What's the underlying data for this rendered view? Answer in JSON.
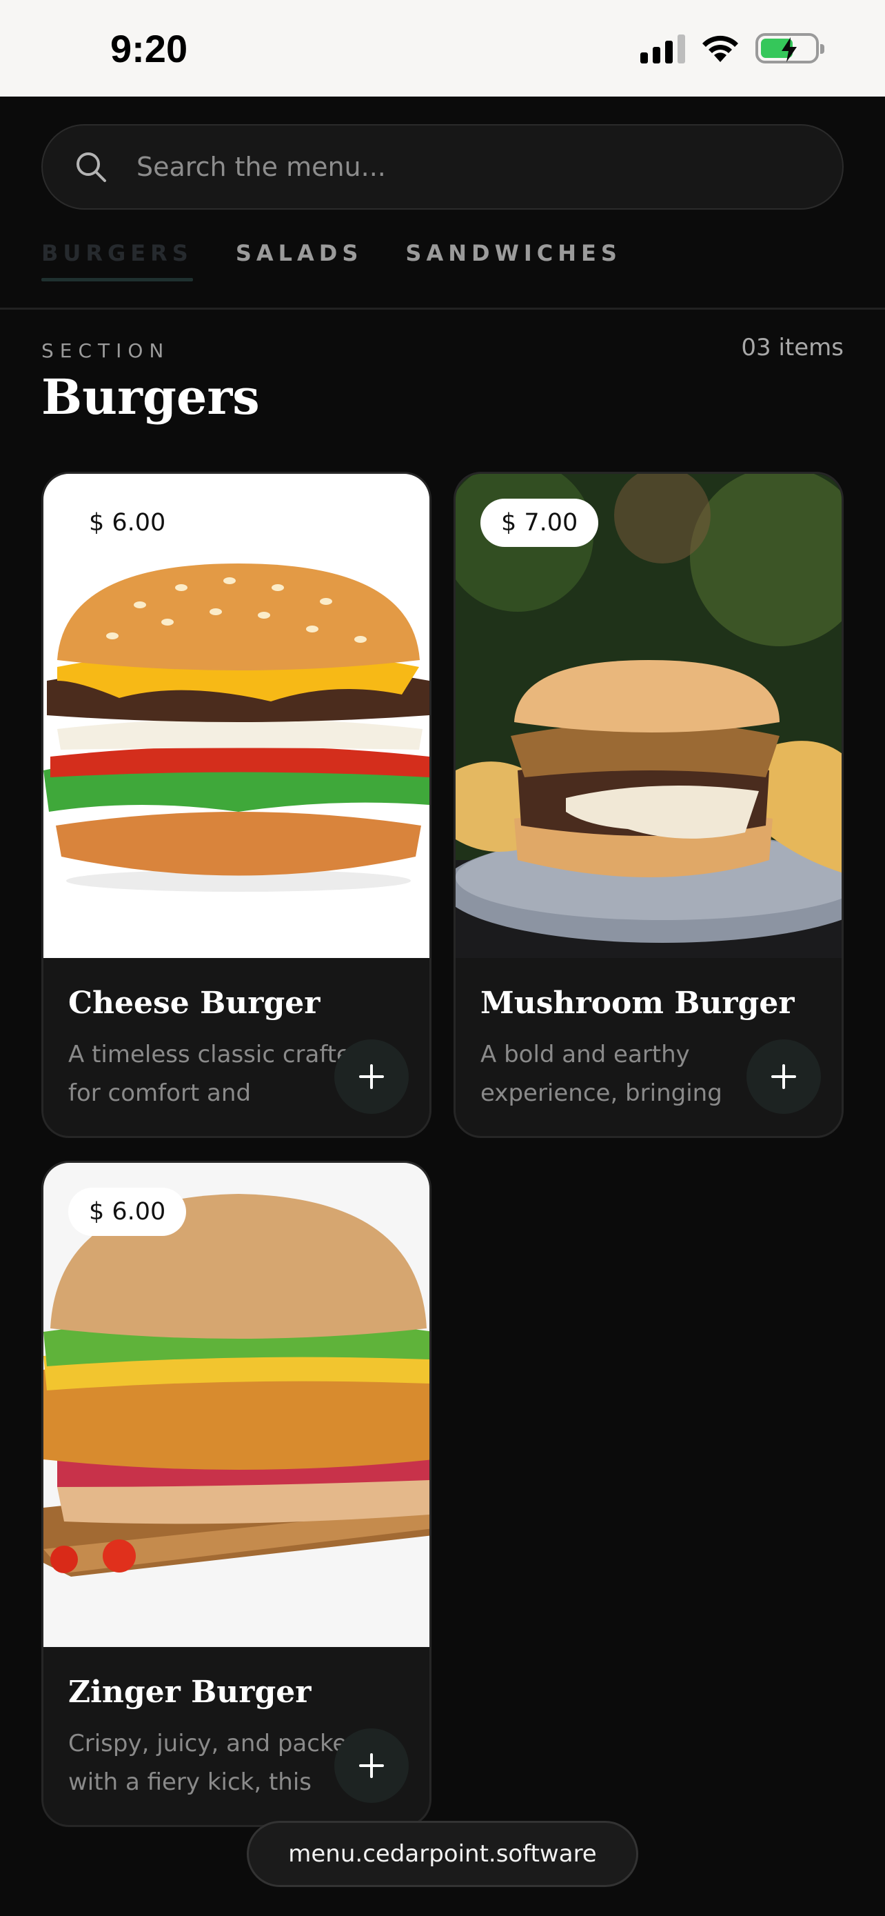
{
  "status_bar": {
    "time": "9:20",
    "signal_icon": "cellular-signal-icon",
    "wifi_icon": "wifi-icon",
    "battery_icon": "battery-charging-icon"
  },
  "search": {
    "placeholder": "Search the menu...",
    "value": "",
    "icon": "search-icon"
  },
  "tabs": [
    {
      "label": "BURGERS",
      "active": true
    },
    {
      "label": "SALADS",
      "active": false
    },
    {
      "label": "SANDWICHES",
      "active": false
    }
  ],
  "section": {
    "eyebrow": "SECTION",
    "title": "Burgers",
    "count": "03 items"
  },
  "items": [
    {
      "name": "Cheese Burger",
      "price": "$ 6.00",
      "description": "A timeless classic crafted for comfort and satisfaction.",
      "image": "cheese-burger-photo"
    },
    {
      "name": "Mushroom Burger",
      "price": "$ 7.00",
      "description": "A bold and earthy experience, bringing together",
      "image": "mushroom-burger-photo"
    },
    {
      "name": "Zinger Burger",
      "price": "$ 6.00",
      "description": "Crispy, juicy, and packed with a fiery kick, this burger...",
      "image": "zinger-burger-photo"
    }
  ],
  "footer": {
    "url": "menu.cedarpoint.software"
  },
  "colors": {
    "background": "#0b0b0b",
    "card": "#161616",
    "accent": "#1f3130",
    "status_bar": "#f7f6f4",
    "battery": "#35c75a"
  }
}
